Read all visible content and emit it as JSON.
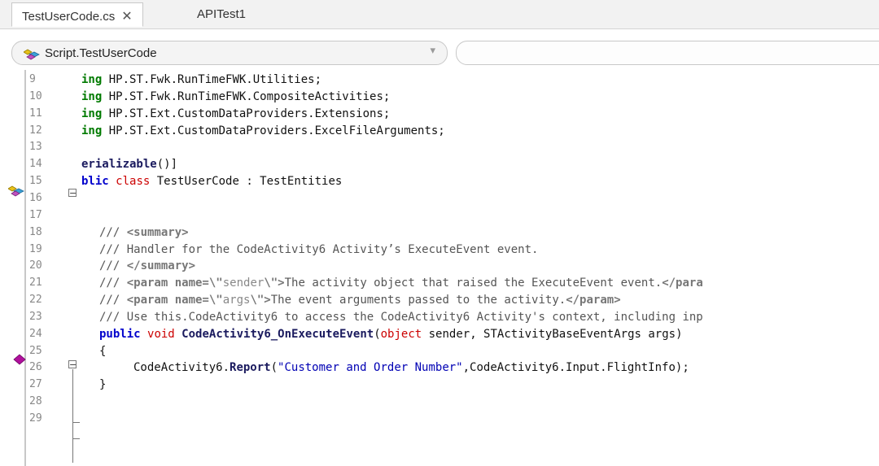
{
  "tabs": [
    {
      "label": "TestUserCode.cs",
      "close_glyph": "✕",
      "active": true
    },
    {
      "label": "APITest1",
      "active": false
    }
  ],
  "nav": {
    "class_combo": "Script.TestUserCode",
    "member_combo": ""
  },
  "code_lines": [
    {
      "n": "9",
      "parts": [
        {
          "t": "ing",
          "c": "kwg"
        },
        {
          "t": " HP.ST.Fwk.RunTimeFWK.Utilities;",
          "c": ""
        }
      ]
    },
    {
      "n": "10",
      "parts": [
        {
          "t": "ing",
          "c": "kwg"
        },
        {
          "t": " HP.ST.Fwk.RunTimeFWK.CompositeActivities;",
          "c": ""
        }
      ]
    },
    {
      "n": "11",
      "parts": [
        {
          "t": "ing",
          "c": "kwg"
        },
        {
          "t": " HP.ST.Ext.CustomDataProviders.Extensions;",
          "c": ""
        }
      ]
    },
    {
      "n": "12",
      "parts": [
        {
          "t": "ing",
          "c": "kwg"
        },
        {
          "t": " HP.ST.Ext.CustomDataProviders.ExcelFileArguments;",
          "c": ""
        }
      ]
    },
    {
      "n": "13",
      "parts": []
    },
    {
      "n": "14",
      "parts": [
        {
          "t": "erializable",
          "c": "meth"
        },
        {
          "t": "()]",
          "c": ""
        }
      ]
    },
    {
      "n": "15",
      "parts": [
        {
          "t": "blic",
          "c": "kw"
        },
        {
          "t": " ",
          "c": ""
        },
        {
          "t": "class",
          "c": "kw2"
        },
        {
          "t": " TestUserCode : TestEntities",
          "c": ""
        }
      ]
    },
    {
      "n": "16",
      "parts": []
    },
    {
      "n": "17",
      "parts": []
    },
    {
      "n": "18",
      "indent": "cm",
      "parts": [
        {
          "t": "/// ",
          "c": "cmt"
        },
        {
          "t": "<summary>",
          "c": "xml"
        }
      ]
    },
    {
      "n": "19",
      "indent": "cm",
      "parts": [
        {
          "t": "/// Handler for the CodeActivity6 Activity’s ExecuteEvent event.",
          "c": "cmt"
        }
      ]
    },
    {
      "n": "20",
      "indent": "cm",
      "parts": [
        {
          "t": "/// ",
          "c": "cmt"
        },
        {
          "t": "</summary>",
          "c": "xml"
        }
      ]
    },
    {
      "n": "21",
      "indent": "cm",
      "parts": [
        {
          "t": "/// ",
          "c": "cmt"
        },
        {
          "t": "<param name=\\\"",
          "c": "xml"
        },
        {
          "t": "sender",
          "c": "attr"
        },
        {
          "t": "\\\">",
          "c": "xml"
        },
        {
          "t": "The activity object that raised the ExecuteEvent event.",
          "c": "cmt"
        },
        {
          "t": "</para",
          "c": "xml"
        }
      ]
    },
    {
      "n": "22",
      "indent": "cm",
      "parts": [
        {
          "t": "/// ",
          "c": "cmt"
        },
        {
          "t": "<param name=\\\"",
          "c": "xml"
        },
        {
          "t": "args",
          "c": "attr"
        },
        {
          "t": "\\\">",
          "c": "xml"
        },
        {
          "t": "The event arguments passed to the activity.",
          "c": "cmt"
        },
        {
          "t": "</param>",
          "c": "xml"
        }
      ]
    },
    {
      "n": "23",
      "indent": "cm",
      "parts": [
        {
          "t": "/// Use this.CodeActivity6 to access the CodeActivity6 Activity's context, including inp",
          "c": "cmt"
        }
      ]
    },
    {
      "n": "24",
      "indent": "cm",
      "parts": [
        {
          "t": "public",
          "c": "kw"
        },
        {
          "t": " ",
          "c": ""
        },
        {
          "t": "void",
          "c": "kw2"
        },
        {
          "t": " ",
          "c": ""
        },
        {
          "t": "CodeActivity6_OnExecuteEvent",
          "c": "meth"
        },
        {
          "t": "(",
          "c": ""
        },
        {
          "t": "object",
          "c": "kw2"
        },
        {
          "t": " sender, STActivityBaseEventArgs args)",
          "c": ""
        }
      ]
    },
    {
      "n": "25",
      "indent": "cm",
      "parts": [
        {
          "t": "{",
          "c": ""
        }
      ]
    },
    {
      "n": "26",
      "indent": "body",
      "parts": [
        {
          "t": "CodeActivity6.",
          "c": ""
        },
        {
          "t": "Report",
          "c": "meth"
        },
        {
          "t": "(",
          "c": ""
        },
        {
          "t": "\"Customer and Order Number\"",
          "c": "str"
        },
        {
          "t": ",CodeActivity6.Input.FlightInfo);",
          "c": ""
        }
      ]
    },
    {
      "n": "27",
      "indent": "cm",
      "parts": [
        {
          "t": "}",
          "c": ""
        }
      ]
    },
    {
      "n": "28",
      "parts": []
    },
    {
      "n": "29",
      "parts": []
    }
  ],
  "colors": {
    "keyword": "#0000cc",
    "type_keyword": "#cc0000",
    "using": "#007a00",
    "string": "#0000b4",
    "comment": "#555555"
  }
}
